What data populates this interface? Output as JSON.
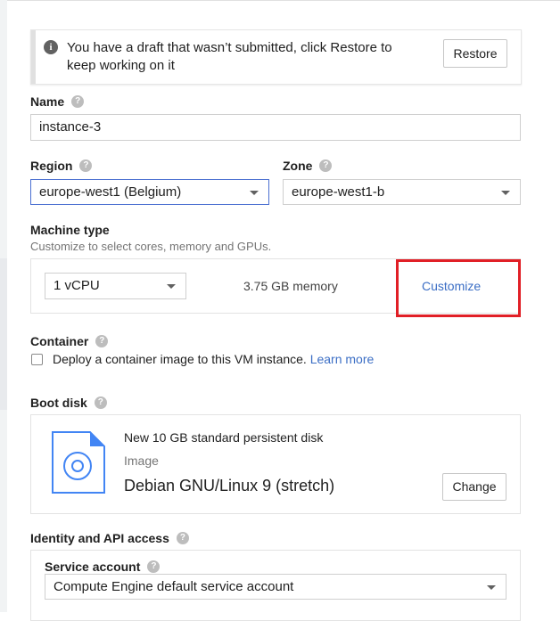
{
  "draft": {
    "message": "You have a draft that wasn’t submitted, click Restore to keep working on it",
    "restore_label": "Restore"
  },
  "name": {
    "label": "Name",
    "value": "instance-3"
  },
  "region": {
    "label": "Region",
    "value": "europe-west1 (Belgium)"
  },
  "zone": {
    "label": "Zone",
    "value": "europe-west1-b"
  },
  "machine_type": {
    "label": "Machine type",
    "description": "Customize to select cores, memory and GPUs.",
    "vcpu": "1 vCPU",
    "memory": "3.75 GB memory",
    "customize_label": "Customize"
  },
  "container": {
    "label": "Container",
    "checkbox_label": "Deploy a container image to this VM instance.",
    "learn_more": "Learn more"
  },
  "boot_disk": {
    "label": "Boot disk",
    "title": "New 10 GB standard persistent disk",
    "image_label": "Image",
    "image_value": "Debian GNU/Linux 9 (stretch)",
    "change_label": "Change"
  },
  "identity": {
    "label": "Identity and API access",
    "service_account_label": "Service account",
    "service_account_value": "Compute Engine default service account"
  },
  "help_glyph": "?",
  "info_glyph": "i",
  "colors": {
    "link": "#3b6ec5",
    "highlight": "#e11f26",
    "focus": "#4a6fd1"
  }
}
